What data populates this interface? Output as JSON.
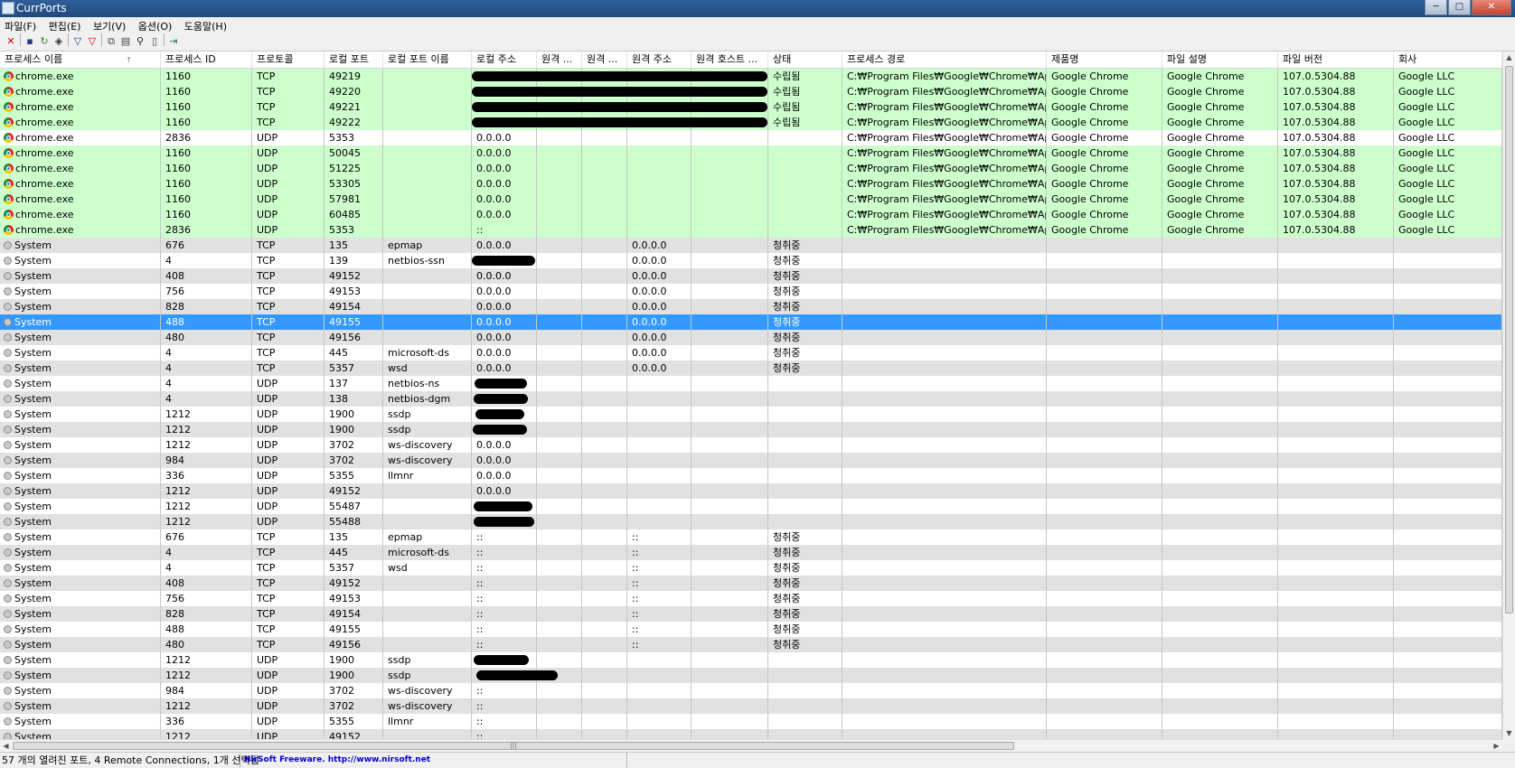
{
  "window": {
    "title": "CurrPorts",
    "buttons": [
      "─",
      "□",
      "✕"
    ]
  },
  "menu": [
    "파일(F)",
    "편집(E)",
    "보기(V)",
    "옵션(O)",
    "도움말(H)"
  ],
  "toolbar": [
    {
      "name": "close-connection-icon",
      "glyph": "✕",
      "color": "#cc0000"
    },
    {
      "name": "save-icon",
      "glyph": "▪",
      "color": "#1f3f7a"
    },
    {
      "name": "refresh-icon",
      "glyph": "↻",
      "color": "#2a8a2a"
    },
    {
      "name": "html-report-icon",
      "glyph": "◈",
      "color": "#333333"
    },
    {
      "name": "filter-icon",
      "glyph": "▽",
      "color": "#1f3f7a"
    },
    {
      "name": "filter-remove-icon",
      "glyph": "▽",
      "color": "#cc0000"
    },
    {
      "name": "copy-icon",
      "glyph": "⧉",
      "color": "#444444"
    },
    {
      "name": "properties-icon",
      "glyph": "▤",
      "color": "#444444"
    },
    {
      "name": "find-icon",
      "glyph": "⚲",
      "color": "#222222"
    },
    {
      "name": "report-icon",
      "glyph": "▯",
      "color": "#444444"
    },
    {
      "name": "exit-icon",
      "glyph": "⇥",
      "color": "#1a7a7a"
    }
  ],
  "columns": [
    "프로세스 이름",
    "프로세스 ID",
    "프로토콜",
    "로컬 포트",
    "로컬 포트 이름",
    "로컬 주소",
    "원격 ...",
    "원격 ...",
    "원격 주소",
    "원격 호스트 ...",
    "상태",
    "프로세스 경로",
    "제품명",
    "파일 설명",
    "파일 버전",
    "회사"
  ],
  "sort_indicator": "↑",
  "rows": [
    [
      "chrome.exe",
      "1160",
      "TCP",
      "49219",
      "",
      "",
      "",
      "",
      "",
      "",
      "수립됨",
      "C:₩Program Files₩Google₩Chrome₩Applic...",
      "Google Chrome",
      "Google Chrome",
      "107.0.5304.88",
      "Google LLC"
    ],
    [
      "chrome.exe",
      "1160",
      "TCP",
      "49220",
      "",
      "",
      "",
      "",
      "",
      "",
      "수립됨",
      "C:₩Program Files₩Google₩Chrome₩Applic...",
      "Google Chrome",
      "Google Chrome",
      "107.0.5304.88",
      "Google LLC"
    ],
    [
      "chrome.exe",
      "1160",
      "TCP",
      "49221",
      "",
      "",
      "",
      "",
      "",
      "",
      "수립됨",
      "C:₩Program Files₩Google₩Chrome₩Applic...",
      "Google Chrome",
      "Google Chrome",
      "107.0.5304.88",
      "Google LLC"
    ],
    [
      "chrome.exe",
      "1160",
      "TCP",
      "49222",
      "",
      "",
      "",
      "",
      "",
      "",
      "수립됨",
      "C:₩Program Files₩Google₩Chrome₩Applic...",
      "Google Chrome",
      "Google Chrome",
      "107.0.5304.88",
      "Google LLC"
    ],
    [
      "chrome.exe",
      "2836",
      "UDP",
      "5353",
      "",
      "0.0.0.0",
      "",
      "",
      "",
      "",
      "",
      "C:₩Program Files₩Google₩Chrome₩Applic...",
      "Google Chrome",
      "Google Chrome",
      "107.0.5304.88",
      "Google LLC"
    ],
    [
      "chrome.exe",
      "1160",
      "UDP",
      "50045",
      "",
      "0.0.0.0",
      "",
      "",
      "",
      "",
      "",
      "C:₩Program Files₩Google₩Chrome₩Applic...",
      "Google Chrome",
      "Google Chrome",
      "107.0.5304.88",
      "Google LLC"
    ],
    [
      "chrome.exe",
      "1160",
      "UDP",
      "51225",
      "",
      "0.0.0.0",
      "",
      "",
      "",
      "",
      "",
      "C:₩Program Files₩Google₩Chrome₩Applic...",
      "Google Chrome",
      "Google Chrome",
      "107.0.5304.88",
      "Google LLC"
    ],
    [
      "chrome.exe",
      "1160",
      "UDP",
      "53305",
      "",
      "0.0.0.0",
      "",
      "",
      "",
      "",
      "",
      "C:₩Program Files₩Google₩Chrome₩Applic...",
      "Google Chrome",
      "Google Chrome",
      "107.0.5304.88",
      "Google LLC"
    ],
    [
      "chrome.exe",
      "1160",
      "UDP",
      "57981",
      "",
      "0.0.0.0",
      "",
      "",
      "",
      "",
      "",
      "C:₩Program Files₩Google₩Chrome₩Applic...",
      "Google Chrome",
      "Google Chrome",
      "107.0.5304.88",
      "Google LLC"
    ],
    [
      "chrome.exe",
      "1160",
      "UDP",
      "60485",
      "",
      "0.0.0.0",
      "",
      "",
      "",
      "",
      "",
      "C:₩Program Files₩Google₩Chrome₩Applic...",
      "Google Chrome",
      "Google Chrome",
      "107.0.5304.88",
      "Google LLC"
    ],
    [
      "chrome.exe",
      "2836",
      "UDP",
      "5353",
      "",
      "::",
      "",
      "",
      "",
      "",
      "",
      "C:₩Program Files₩Google₩Chrome₩Applic...",
      "Google Chrome",
      "Google Chrome",
      "107.0.5304.88",
      "Google LLC"
    ],
    [
      "System",
      "676",
      "TCP",
      "135",
      "epmap",
      "0.0.0.0",
      "",
      "",
      "0.0.0.0",
      "",
      "청취중",
      "",
      "",
      "",
      "",
      ""
    ],
    [
      "System",
      "4",
      "TCP",
      "139",
      "netbios-ssn",
      "",
      "",
      "",
      "0.0.0.0",
      "",
      "청취중",
      "",
      "",
      "",
      "",
      ""
    ],
    [
      "System",
      "408",
      "TCP",
      "49152",
      "",
      "0.0.0.0",
      "",
      "",
      "0.0.0.0",
      "",
      "청취중",
      "",
      "",
      "",
      "",
      ""
    ],
    [
      "System",
      "756",
      "TCP",
      "49153",
      "",
      "0.0.0.0",
      "",
      "",
      "0.0.0.0",
      "",
      "청취중",
      "",
      "",
      "",
      "",
      ""
    ],
    [
      "System",
      "828",
      "TCP",
      "49154",
      "",
      "0.0.0.0",
      "",
      "",
      "0.0.0.0",
      "",
      "청취중",
      "",
      "",
      "",
      "",
      ""
    ],
    [
      "System",
      "488",
      "TCP",
      "49155",
      "",
      "0.0.0.0",
      "",
      "",
      "0.0.0.0",
      "",
      "청취중",
      "",
      "",
      "",
      "",
      ""
    ],
    [
      "System",
      "480",
      "TCP",
      "49156",
      "",
      "0.0.0.0",
      "",
      "",
      "0.0.0.0",
      "",
      "청취중",
      "",
      "",
      "",
      "",
      ""
    ],
    [
      "System",
      "4",
      "TCP",
      "445",
      "microsoft-ds",
      "0.0.0.0",
      "",
      "",
      "0.0.0.0",
      "",
      "청취중",
      "",
      "",
      "",
      "",
      ""
    ],
    [
      "System",
      "4",
      "TCP",
      "5357",
      "wsd",
      "0.0.0.0",
      "",
      "",
      "0.0.0.0",
      "",
      "청취중",
      "",
      "",
      "",
      "",
      ""
    ],
    [
      "System",
      "4",
      "UDP",
      "137",
      "netbios-ns",
      "",
      "",
      "",
      "",
      "",
      "",
      "",
      "",
      "",
      "",
      ""
    ],
    [
      "System",
      "4",
      "UDP",
      "138",
      "netbios-dgm",
      "",
      "",
      "",
      "",
      "",
      "",
      "",
      "",
      "",
      "",
      ""
    ],
    [
      "System",
      "1212",
      "UDP",
      "1900",
      "ssdp",
      "",
      "",
      "",
      "",
      "",
      "",
      "",
      "",
      "",
      "",
      ""
    ],
    [
      "System",
      "1212",
      "UDP",
      "1900",
      "ssdp",
      "",
      "",
      "",
      "",
      "",
      "",
      "",
      "",
      "",
      "",
      ""
    ],
    [
      "System",
      "1212",
      "UDP",
      "3702",
      "ws-discovery",
      "0.0.0.0",
      "",
      "",
      "",
      "",
      "",
      "",
      "",
      "",
      "",
      ""
    ],
    [
      "System",
      "984",
      "UDP",
      "3702",
      "ws-discovery",
      "0.0.0.0",
      "",
      "",
      "",
      "",
      "",
      "",
      "",
      "",
      "",
      ""
    ],
    [
      "System",
      "336",
      "UDP",
      "5355",
      "llmnr",
      "0.0.0.0",
      "",
      "",
      "",
      "",
      "",
      "",
      "",
      "",
      "",
      ""
    ],
    [
      "System",
      "1212",
      "UDP",
      "49152",
      "",
      "0.0.0.0",
      "",
      "",
      "",
      "",
      "",
      "",
      "",
      "",
      "",
      ""
    ],
    [
      "System",
      "1212",
      "UDP",
      "55487",
      "",
      "",
      "",
      "",
      "",
      "",
      "",
      "",
      "",
      "",
      "",
      ""
    ],
    [
      "System",
      "1212",
      "UDP",
      "55488",
      "",
      "",
      "",
      "",
      "",
      "",
      "",
      "",
      "",
      "",
      "",
      ""
    ],
    [
      "System",
      "676",
      "TCP",
      "135",
      "epmap",
      "::",
      "",
      "",
      "::",
      "",
      "청취중",
      "",
      "",
      "",
      "",
      ""
    ],
    [
      "System",
      "4",
      "TCP",
      "445",
      "microsoft-ds",
      "::",
      "",
      "",
      "::",
      "",
      "청취중",
      "",
      "",
      "",
      "",
      ""
    ],
    [
      "System",
      "4",
      "TCP",
      "5357",
      "wsd",
      "::",
      "",
      "",
      "::",
      "",
      "청취중",
      "",
      "",
      "",
      "",
      ""
    ],
    [
      "System",
      "408",
      "TCP",
      "49152",
      "",
      "::",
      "",
      "",
      "::",
      "",
      "청취중",
      "",
      "",
      "",
      "",
      ""
    ],
    [
      "System",
      "756",
      "TCP",
      "49153",
      "",
      "::",
      "",
      "",
      "::",
      "",
      "청취중",
      "",
      "",
      "",
      "",
      ""
    ],
    [
      "System",
      "828",
      "TCP",
      "49154",
      "",
      "::",
      "",
      "",
      "::",
      "",
      "청취중",
      "",
      "",
      "",
      "",
      ""
    ],
    [
      "System",
      "488",
      "TCP",
      "49155",
      "",
      "::",
      "",
      "",
      "::",
      "",
      "청취중",
      "",
      "",
      "",
      "",
      ""
    ],
    [
      "System",
      "480",
      "TCP",
      "49156",
      "",
      "::",
      "",
      "",
      "::",
      "",
      "청취중",
      "",
      "",
      "",
      "",
      ""
    ],
    [
      "System",
      "1212",
      "UDP",
      "1900",
      "ssdp",
      "",
      "",
      "",
      "",
      "",
      "",
      "",
      "",
      "",
      "",
      ""
    ],
    [
      "System",
      "1212",
      "UDP",
      "1900",
      "ssdp",
      "",
      "",
      "",
      "",
      "",
      "",
      "",
      "",
      "",
      "",
      ""
    ],
    [
      "System",
      "984",
      "UDP",
      "3702",
      "ws-discovery",
      "::",
      "",
      "",
      "",
      "",
      "",
      "",
      "",
      "",
      "",
      ""
    ],
    [
      "System",
      "1212",
      "UDP",
      "3702",
      "ws-discovery",
      "::",
      "",
      "",
      "",
      "",
      "",
      "",
      "",
      "",
      "",
      ""
    ],
    [
      "System",
      "336",
      "UDP",
      "5355",
      "llmnr",
      "::",
      "",
      "",
      "",
      "",
      "",
      "",
      "",
      "",
      "",
      ""
    ],
    [
      "System",
      "1212",
      "UDP",
      "49152",
      "",
      "::",
      "",
      "",
      "",
      "",
      "",
      "",
      "",
      "",
      "",
      ""
    ]
  ],
  "row_styles": [
    "green",
    "green",
    "green",
    "green",
    "white",
    "green",
    "green",
    "green",
    "green",
    "green",
    "green",
    "gray",
    "white",
    "gray",
    "white",
    "gray",
    "sel",
    "gray",
    "white",
    "gray",
    "white",
    "gray",
    "white",
    "gray",
    "white",
    "gray",
    "white",
    "gray",
    "white",
    "gray",
    "white",
    "gray",
    "white",
    "gray",
    "white",
    "gray",
    "white",
    "gray",
    "white",
    "gray",
    "white",
    "gray",
    "white",
    "gray"
  ],
  "redacted_note": "black marker redactions over local/remote address values",
  "status": {
    "summary": "57 개의 열려진 포트, 4 Remote Connections, 1개 선택됨",
    "link": "NirSoft Freeware.  http://www.nirsoft.net"
  },
  "colors": {
    "green_row": "#ccffcc",
    "selected_row": "#3399ff",
    "alt_row": "#e1e1e1"
  }
}
